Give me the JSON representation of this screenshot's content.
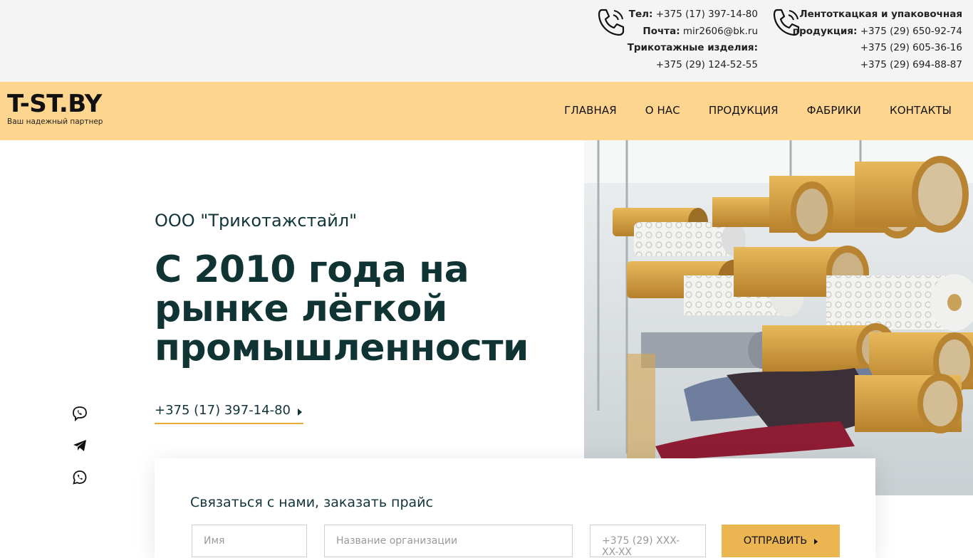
{
  "contacts": {
    "tel_label": "Тел:",
    "tel_value": "+375 (17) 397-14-80",
    "mail_label": "Почта:",
    "mail_value": "mir2606@bk.ru",
    "knit_label": "Трикотажные изделия:",
    "knit_phone": "+375 (29) 124-52-55",
    "tape_label_1": "Лентоткацкая и упаковочная",
    "tape_label_2": "продукция:",
    "tape_phone_1": "+375 (29) 650-92-74",
    "tape_phone_2": "+375 (29) 605-36-16",
    "tape_phone_3": "+375 (29) 694-88-87"
  },
  "logo": {
    "title": "T-ST.BY",
    "subtitle": "Ваш надежный партнер"
  },
  "nav": {
    "items": [
      "ГЛАВНАЯ",
      "О НАС",
      "ПРОДУКЦИЯ",
      "ФАБРИКИ",
      "КОНТАКТЫ"
    ]
  },
  "hero": {
    "company": "ООО \"Трикотажстайл\"",
    "headline": "С 2010 года на рынке лёгкой промышленности",
    "phone": "+375 (17) 397-14-80"
  },
  "social": {
    "icons": [
      "viber-icon",
      "telegram-icon",
      "whatsapp-icon"
    ]
  },
  "form": {
    "title": "Связаться с нами, заказать прайс",
    "name_placeholder": "Имя",
    "org_placeholder": "Название организации",
    "phone_placeholder": "+375 (29) XXX-XX-XX",
    "submit_label": "ОТПРАВИТЬ"
  },
  "colors": {
    "topbar_bg": "#f4f4f4",
    "navbar_bg": "#fed58f",
    "accent": "#ebb552",
    "heading": "#0f3433"
  }
}
